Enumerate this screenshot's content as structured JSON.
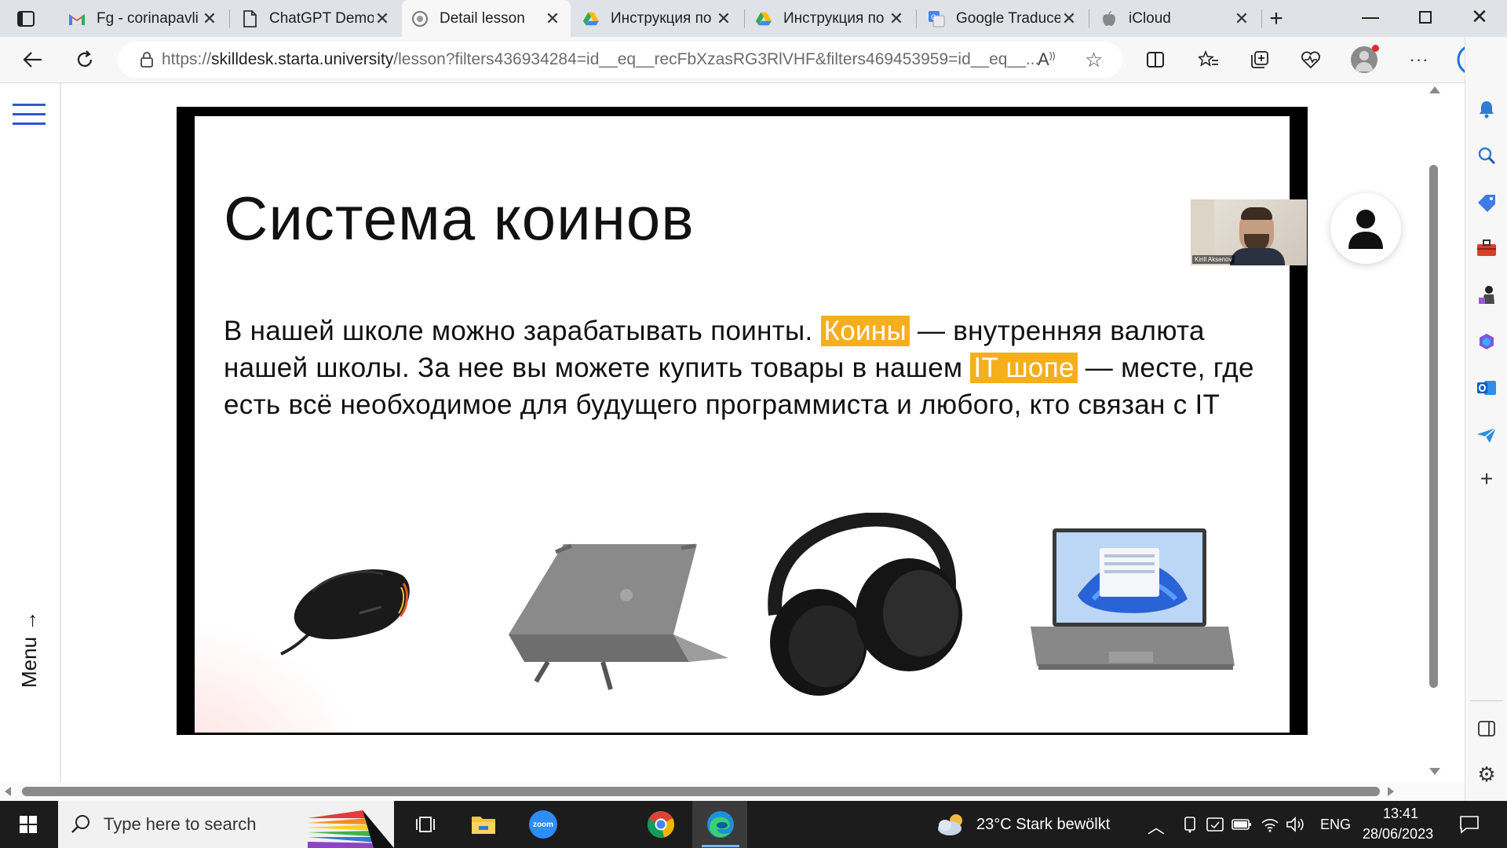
{
  "tabs": [
    {
      "label": "Fg - corinapavli",
      "icon": "gmail-icon",
      "active": false
    },
    {
      "label": "ChatGPT Demo",
      "icon": "document-icon",
      "active": false
    },
    {
      "label": "Detail lesson",
      "icon": "site-icon",
      "active": true
    },
    {
      "label": "Инструкция по",
      "icon": "google-drive-icon",
      "active": false
    },
    {
      "label": "Инструкция по",
      "icon": "google-drive-icon",
      "active": false
    },
    {
      "label": "Google Traduce",
      "icon": "google-translate-icon",
      "active": false
    },
    {
      "label": "iCloud",
      "icon": "apple-icon",
      "active": false
    }
  ],
  "address": {
    "protocol": "https://",
    "host": "skilldesk.starta.university",
    "path": "/lesson?filters436934284=id__eq__recFbXzasRG3RlVHF&filters469453959=id__eq__..."
  },
  "page": {
    "menu_label": "Menu",
    "slide": {
      "title": "Система коинов",
      "body_part1": "В нашей школе можно зарабатывать поинты.",
      "highlight1": "Коины",
      "body_part2": " — внутренняя валюта нашей школы. За нее вы можете купить товары в нашем ",
      "highlight2": "IT шопе",
      "body_part3": " — месте, где есть всё необходимое для будущего программиста и любого, кто связан с IT",
      "products": [
        "mouse",
        "laptop-case",
        "headphones",
        "laptop"
      ]
    },
    "webcam_name": "Kirill Aksenov"
  },
  "taskbar": {
    "search_placeholder": "Type here to search",
    "zoom_label": "zoom",
    "weather": "23°C  Stark bewölkt",
    "lang": "ENG",
    "time": "13:41",
    "date": "28/06/2023"
  },
  "colors": {
    "accent": "#2f56d4",
    "highlight": "#f7ae1d"
  }
}
